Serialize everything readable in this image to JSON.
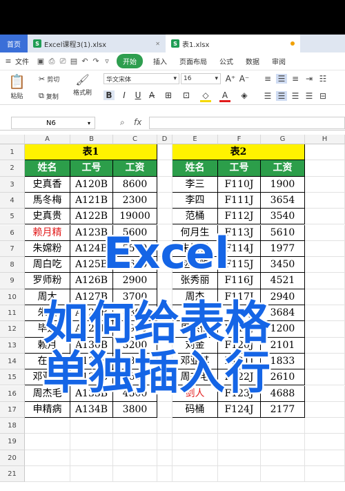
{
  "tabs": {
    "home": "首页",
    "file1": "Excel课程3(1).xlsx",
    "file2": "表1.xlsx",
    "icon_label": "S"
  },
  "menu": {
    "file": "文件",
    "start": "开始",
    "insert": "插入",
    "layout": "页面布局",
    "formula": "公式",
    "data": "数据",
    "review": "审阅"
  },
  "ribbon": {
    "paste": "粘贴",
    "cut": "剪切",
    "copy": "复制",
    "format_painter": "格式刷",
    "font": "华文宋体",
    "size": "16",
    "bold": "B",
    "italic": "I",
    "underline": "U"
  },
  "formula_bar": {
    "name_box": "N6",
    "fx": "fx"
  },
  "columns": [
    "A",
    "B",
    "C",
    "D",
    "E",
    "F",
    "G",
    "H"
  ],
  "rows": [
    "1",
    "2",
    "3",
    "4",
    "5",
    "6",
    "7",
    "8",
    "9",
    "10",
    "11",
    "12",
    "13",
    "14",
    "15",
    "16",
    "17",
    "18",
    "19",
    "20",
    "21"
  ],
  "table1": {
    "title": "表1",
    "headers": [
      "姓名",
      "工号",
      "工资"
    ],
    "rows": [
      [
        "史真香",
        "A120B",
        "8600"
      ],
      [
        "馬冬梅",
        "A121B",
        "2300"
      ],
      [
        "史真贵",
        "A122B",
        "19000"
      ],
      [
        "赖月精",
        "A123B",
        "5600"
      ],
      [
        "朱嫦粉",
        "A124B",
        "5500"
      ],
      [
        "周白吃",
        "A125B",
        "4600"
      ],
      [
        "罗师粉",
        "A126B",
        "2900"
      ],
      [
        "周大",
        "A127B",
        "3700"
      ],
      [
        "朱肢",
        "A128B",
        "4300"
      ],
      [
        "毕运",
        "A129B",
        "3900"
      ],
      [
        "赖月",
        "A130B",
        "3200"
      ],
      [
        "在消",
        "A131B",
        "3800"
      ],
      [
        "邓亚其",
        "A132B",
        "3600"
      ],
      [
        "周杰毛",
        "A133B",
        "4500"
      ],
      [
        "申精病",
        "A134B",
        "3800"
      ]
    ]
  },
  "table2": {
    "title": "表2",
    "headers": [
      "姓名",
      "工号",
      "工资"
    ],
    "rows": [
      [
        "李三",
        "F110J",
        "1900"
      ],
      [
        "李四",
        "F111J",
        "3654"
      ],
      [
        "范桶",
        "F112J",
        "3540"
      ],
      [
        "何月生",
        "F113J",
        "5610"
      ],
      [
        "朱嫦粉",
        "F114J",
        "1977"
      ],
      [
        "赵白吃",
        "F115J",
        "3450"
      ],
      [
        "张秀丽",
        "F116J",
        "4521"
      ],
      [
        "周杰",
        "F117J",
        "2940"
      ],
      [
        "张三",
        "F118J",
        "3684"
      ],
      [
        "周杰伦",
        "F119J",
        "1200"
      ],
      [
        "刘金",
        "F120J",
        "2101"
      ],
      [
        "邓亚其",
        "F121J",
        "1833"
      ],
      [
        "周杰毛",
        "F122J",
        "2610"
      ],
      [
        "剑人",
        "F123J",
        "4688"
      ],
      [
        "码桶",
        "F124J",
        "2177"
      ]
    ]
  },
  "overlay": {
    "line1": "Excel",
    "line2": "如何给表格",
    "line3": "单独插入行"
  },
  "colors": {
    "title_bg": "#fff200",
    "header_bg": "#2c9e4a",
    "overlay_text": "#1565e6",
    "red_text": "#e21b1b"
  }
}
